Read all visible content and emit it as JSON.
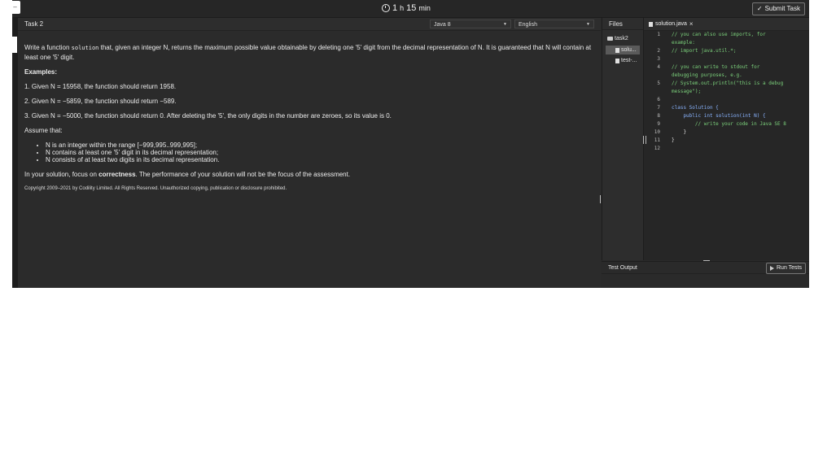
{
  "topbar": {
    "menu_label": "–",
    "timer": {
      "hours": "1",
      "h_unit": "h",
      "minutes": "15",
      "min_unit": "min"
    },
    "submit_label": "Submit Task"
  },
  "task": {
    "title": "Task 2",
    "language_select": "Java 8",
    "locale_select": "English",
    "statement_pre": "Write a function ",
    "statement_code": "solution",
    "statement_post": " that, given an integer N, returns the maximum possible value obtainable by deleting one '5' digit from the decimal representation of N. It is guaranteed that N will contain at least one '5' digit.",
    "examples_heading": "Examples:",
    "examples": [
      "1. Given N = 15958, the function should return 1958.",
      "2. Given N = −5859, the function should return −589.",
      "3. Given N = −5000, the function should return 0. After deleting the '5', the only digits in the number are zeroes, so its value is 0."
    ],
    "assume_heading": "Assume that:",
    "assumptions": [
      "N is an integer within the range [−999,995..999,995];",
      "N contains at least one '5' digit in its decimal representation;",
      "N consists of at least two digits in its decimal representation."
    ],
    "focus_pre": "In your solution, focus on ",
    "focus_bold": "correctness",
    "focus_post": ". The performance of your solution will not be the focus of the assessment.",
    "copyright": "Copyright 2009–2021 by Codility Limited. All Rights Reserved. Unauthorized copying, publication or disclosure prohibited."
  },
  "files": {
    "header": "Files",
    "folder": "task2",
    "items": [
      "solu...",
      "test-..."
    ]
  },
  "editor": {
    "tab_label": "solution.java",
    "lines": [
      {
        "n": "1",
        "text": "// you can also use imports, for",
        "kind": "comment"
      },
      {
        "n": "",
        "text": "example:",
        "kind": "comment"
      },
      {
        "n": "2",
        "text": "// import java.util.*;",
        "kind": "comment"
      },
      {
        "n": "3",
        "text": "",
        "kind": "plain"
      },
      {
        "n": "4",
        "text": "// you can write to stdout for",
        "kind": "comment"
      },
      {
        "n": "",
        "text": "debugging purposes, e.g.",
        "kind": "comment"
      },
      {
        "n": "5",
        "text": "// System.out.println(\"this is a debug",
        "kind": "comment"
      },
      {
        "n": "",
        "text": "message\");",
        "kind": "comment"
      },
      {
        "n": "6",
        "text": "",
        "kind": "plain"
      },
      {
        "n": "7",
        "text": "class Solution {",
        "kind": "kw"
      },
      {
        "n": "8",
        "text": "    public int solution(int N) {",
        "kind": "kw"
      },
      {
        "n": "9",
        "text": "        // write your code in Java SE 8",
        "kind": "comment"
      },
      {
        "n": "10",
        "text": "    }",
        "kind": "plain"
      },
      {
        "n": "11",
        "text": "}",
        "kind": "plain"
      },
      {
        "n": "12",
        "text": "",
        "kind": "plain"
      }
    ]
  },
  "output": {
    "header": "Test Output",
    "run_label": "Run Tests"
  }
}
